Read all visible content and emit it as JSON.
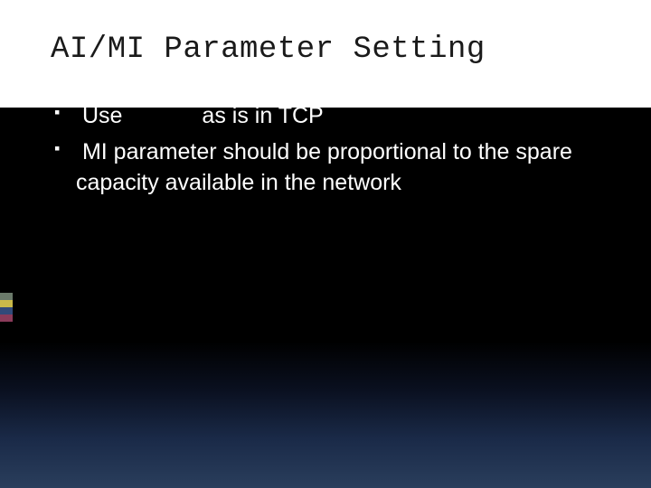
{
  "title": "AI/MI Parameter Setting",
  "bullets": [
    {
      "pre": "Use",
      "post": "as is in TCP"
    },
    {
      "text": "MI parameter should be proportional to the spare capacity available in the network"
    }
  ]
}
